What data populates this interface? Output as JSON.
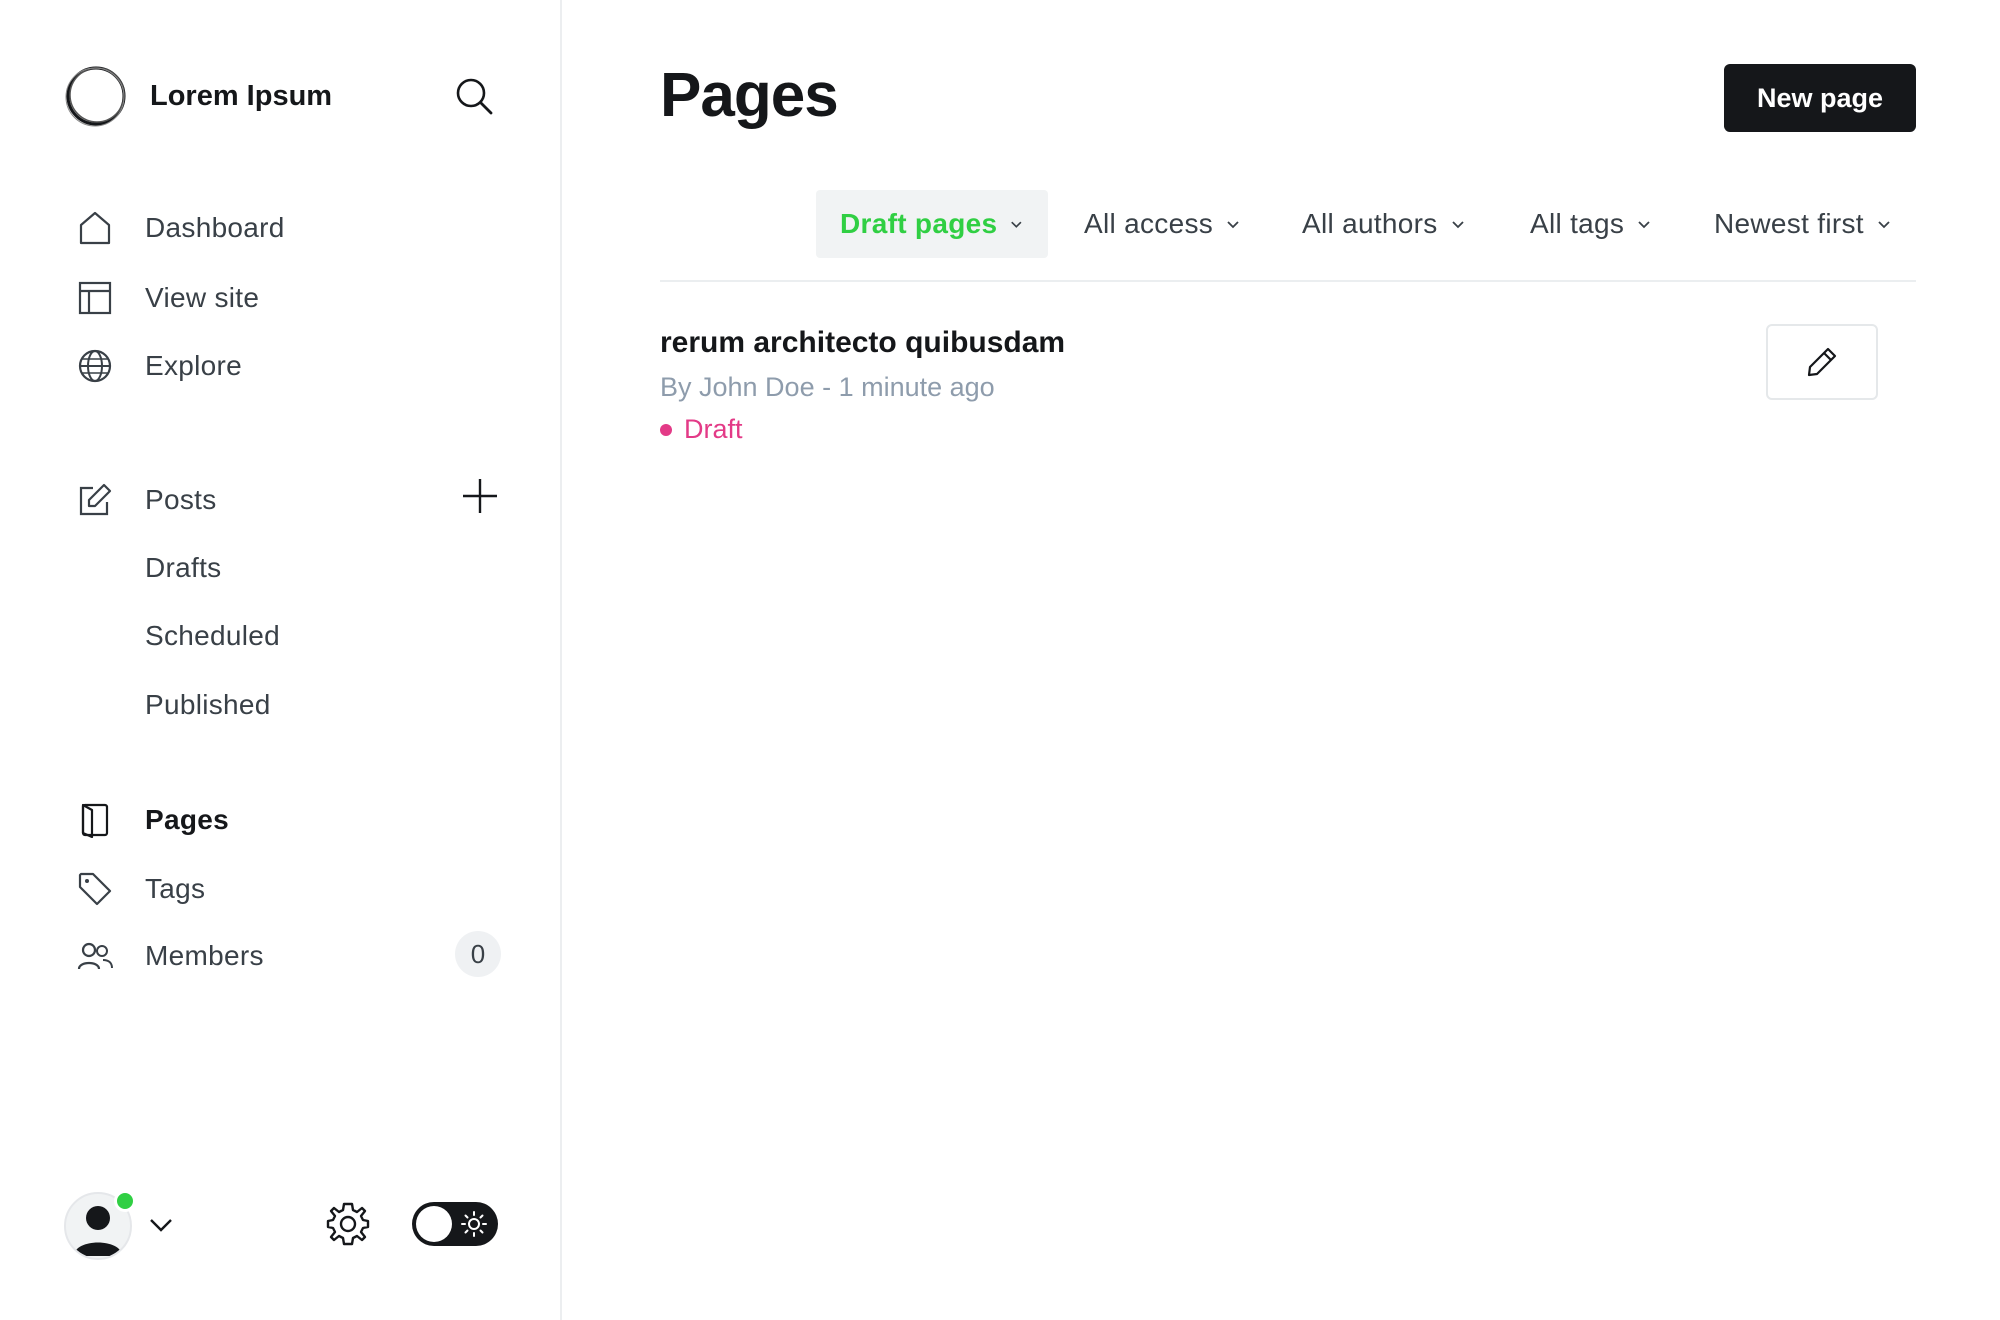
{
  "brand": {
    "name": "Lorem Ipsum"
  },
  "sidebar": {
    "nav": [
      {
        "label": "Dashboard",
        "icon": "home-icon"
      },
      {
        "label": "View site",
        "icon": "layout-icon"
      },
      {
        "label": "Explore",
        "icon": "globe-icon"
      }
    ],
    "posts": {
      "label": "Posts",
      "icon": "edit-icon",
      "sub": [
        "Drafts",
        "Scheduled",
        "Published"
      ]
    },
    "section2": [
      {
        "label": "Pages",
        "icon": "page-icon",
        "active": true
      },
      {
        "label": "Tags",
        "icon": "tag-icon"
      },
      {
        "label": "Members",
        "icon": "members-icon",
        "count": "0"
      }
    ]
  },
  "main": {
    "title": "Pages",
    "new_button": "New page",
    "filters": [
      {
        "label": "Draft pages",
        "active": true
      },
      {
        "label": "All access"
      },
      {
        "label": "All authors"
      },
      {
        "label": "All tags"
      },
      {
        "label": "Newest first"
      }
    ],
    "items": [
      {
        "title": "rerum architecto quibusdam",
        "meta": "By John Doe - 1 minute ago",
        "status": "Draft"
      }
    ]
  },
  "colors": {
    "accent_green": "#30cf43",
    "draft_pink": "#e33a87",
    "dark": "#15171a"
  }
}
